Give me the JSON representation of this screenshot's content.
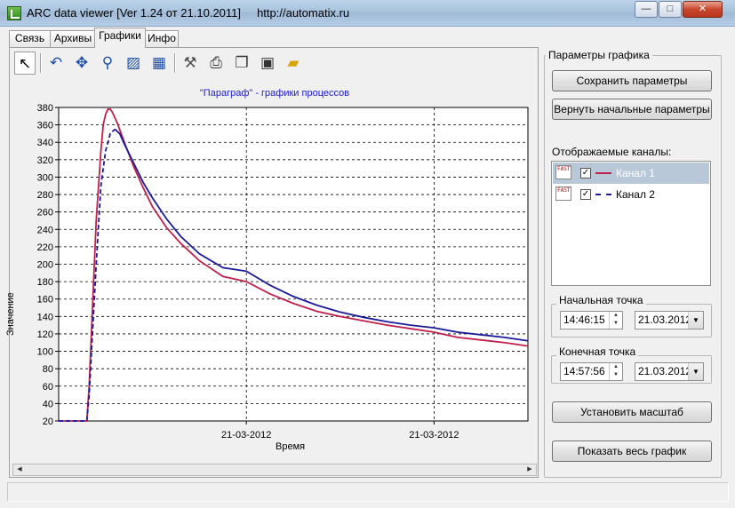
{
  "window": {
    "title": "ARC data viewer [Ver 1.24 от 21.10.2011]     http://automatix.ru",
    "minimize_glyph": "—",
    "maximize_glyph": "□",
    "close_glyph": "✕"
  },
  "tabs": [
    {
      "label": "Связь"
    },
    {
      "label": "Архивы"
    },
    {
      "label": "Графики"
    },
    {
      "label": "Инфо"
    }
  ],
  "toolbar": {
    "tools": [
      {
        "icon": "arrow-cursor-icon",
        "glyph": "↖"
      },
      {
        "icon": "undo-icon",
        "glyph": "↶"
      },
      {
        "icon": "move-icon",
        "glyph": "✥"
      },
      {
        "icon": "zoom-icon",
        "glyph": "⚲"
      },
      {
        "icon": "export-image-icon",
        "glyph": "▨"
      },
      {
        "icon": "chart-export-icon",
        "glyph": "▦"
      },
      {
        "icon": "settings-icon",
        "glyph": "⚒"
      },
      {
        "icon": "print-icon",
        "glyph": "⎙"
      },
      {
        "icon": "copy-icon",
        "glyph": "❐"
      },
      {
        "icon": "save-icon",
        "glyph": "▣"
      },
      {
        "icon": "open-folder-icon",
        "glyph": "▰"
      }
    ]
  },
  "chart_data": {
    "type": "line",
    "title": "\"Параграф\" - графики процессов",
    "xlabel": "Время",
    "ylabel": "Значение",
    "ylim": [
      20,
      380
    ],
    "y_ticks": [
      20,
      40,
      60,
      80,
      100,
      120,
      140,
      160,
      180,
      200,
      220,
      240,
      260,
      280,
      300,
      320,
      340,
      360,
      380
    ],
    "x_tick_labels": [
      "21-03-2012",
      "21-03-2012"
    ],
    "x_tick_positions_min": [
      4.0,
      8.0
    ],
    "xlim_min": [
      0,
      10
    ],
    "grid": true,
    "series": [
      {
        "color": "#c0204c",
        "style": "solid",
        "x": [
          0,
          0.6,
          0.65,
          0.8,
          0.9,
          0.95,
          1.0,
          1.05,
          1.1,
          1.15,
          1.25,
          1.4,
          1.6,
          1.8,
          2.0,
          2.3,
          2.6,
          3.0,
          3.5,
          4.0,
          4.5,
          5.0,
          5.5,
          6.0,
          6.5,
          7.0,
          7.5,
          8.0,
          8.5,
          9.0,
          9.5,
          10.0
        ],
        "y": [
          20,
          20,
          60,
          250,
          330,
          360,
          372,
          378,
          378,
          374,
          362,
          340,
          312,
          288,
          266,
          242,
          224,
          204,
          186,
          180,
          166,
          155,
          146,
          140,
          135,
          130,
          126,
          122,
          116,
          113,
          110,
          106
        ]
      },
      {
        "color": "#1a1a9a",
        "style": "dashed-then-solid",
        "x": [
          0,
          0.6,
          0.65,
          0.8,
          0.9,
          1.0,
          1.1,
          1.2,
          1.3,
          1.4,
          1.6,
          1.8,
          2.0,
          2.3,
          2.6,
          3.0,
          3.5,
          4.0,
          4.5,
          5.0,
          5.5,
          6.0,
          6.5,
          7.0,
          7.5,
          8.0,
          8.5,
          9.0,
          9.5,
          10.0
        ],
        "y": [
          20,
          20,
          50,
          200,
          290,
          330,
          350,
          355,
          350,
          338,
          316,
          294,
          276,
          252,
          232,
          212,
          196,
          192,
          176,
          163,
          153,
          145,
          139,
          134,
          130,
          127,
          122,
          119,
          116,
          112
        ]
      }
    ]
  },
  "scrollbar": {
    "left_glyph": "◀",
    "right_glyph": "▶"
  },
  "panel": {
    "group_title": "Параметры графика",
    "save_params_label": "Сохранить параметры",
    "reset_params_label": "Вернуть начальные параметры",
    "channels_title": "Отображаемые каналы:",
    "channels": [
      {
        "name": "Канал 1",
        "checked": "✓",
        "color": "#c0204c",
        "style": "solid",
        "selected": true,
        "icon_text": "FAST"
      },
      {
        "name": "Канал 2",
        "checked": "✓",
        "color": "#1a1a9a",
        "style": "dashed",
        "selected": false,
        "icon_text": "FAST"
      }
    ],
    "start": {
      "title": "Начальная точка",
      "time": "14:46:15",
      "date": "21.03.2012"
    },
    "end": {
      "title": "Конечная точка",
      "time": "14:57:56",
      "date": "21.03.2012"
    },
    "spin_up": "▲",
    "spin_down": "▼",
    "dropdown_glyph": "▼",
    "set_scale_label": "Установить масштаб",
    "show_all_label": "Показать весь график"
  }
}
